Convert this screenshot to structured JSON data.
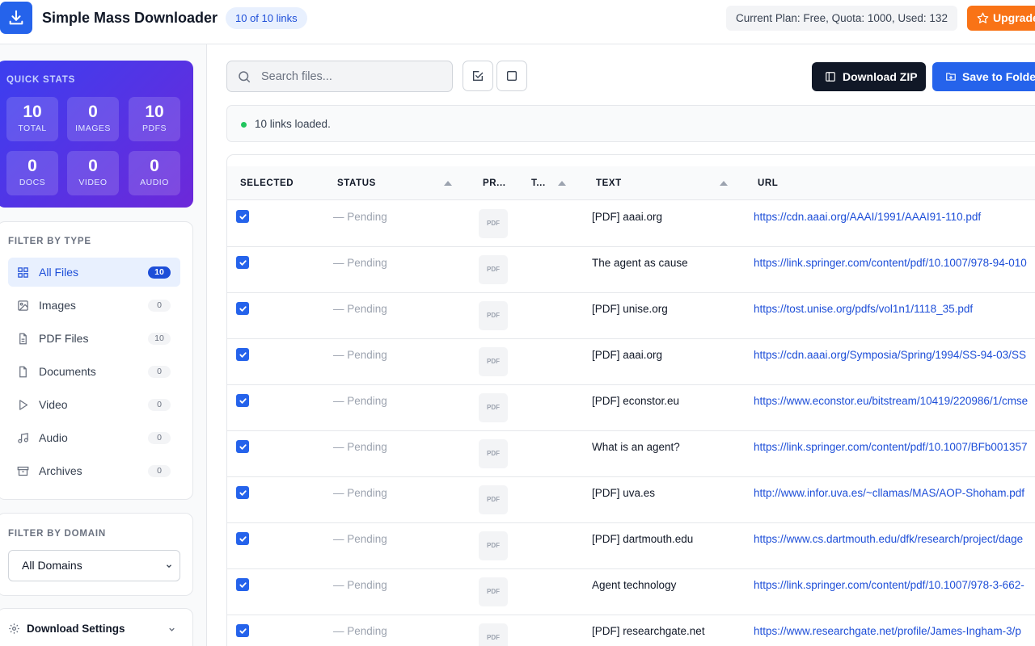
{
  "header": {
    "title": "Simple Mass Downloader",
    "link_count": "10 of 10 links",
    "plan": "Current Plan: Free, Quota: 1000, Used: 132",
    "upgrade_label": "Upgrade"
  },
  "stats": {
    "title": "QUICK STATS",
    "items": [
      {
        "value": "10",
        "label": "TOTAL"
      },
      {
        "value": "0",
        "label": "IMAGES"
      },
      {
        "value": "10",
        "label": "PDFS"
      },
      {
        "value": "0",
        "label": "DOCS"
      },
      {
        "value": "0",
        "label": "VIDEO"
      },
      {
        "value": "0",
        "label": "AUDIO"
      }
    ]
  },
  "filter_type": {
    "title": "FILTER BY TYPE",
    "items": [
      {
        "label": "All Files",
        "count": "10",
        "icon": "grid-icon"
      },
      {
        "label": "Images",
        "count": "0",
        "icon": "image-icon"
      },
      {
        "label": "PDF Files",
        "count": "10",
        "icon": "file-text-icon"
      },
      {
        "label": "Documents",
        "count": "0",
        "icon": "document-icon"
      },
      {
        "label": "Video",
        "count": "0",
        "icon": "play-icon"
      },
      {
        "label": "Audio",
        "count": "0",
        "icon": "music-icon"
      },
      {
        "label": "Archives",
        "count": "0",
        "icon": "archive-icon"
      }
    ]
  },
  "filter_domain": {
    "title": "FILTER BY DOMAIN",
    "selected": "All Domains"
  },
  "settings": {
    "label": "Download Settings"
  },
  "toolbar": {
    "search_placeholder": "Search files...",
    "zip_label": "Download ZIP",
    "folder_label": "Save to Folder"
  },
  "status": {
    "message": "10 links loaded."
  },
  "table": {
    "columns": {
      "selected": "SELECTED",
      "status": "STATUS",
      "preview": "PR...",
      "type": "T...",
      "text": "TEXT",
      "url": "URL"
    },
    "rows": [
      {
        "status": "— Pending",
        "thumb": "PDF",
        "text": "[PDF] aaai.org",
        "url": "https://cdn.aaai.org/AAAI/1991/AAAI91-110.pdf"
      },
      {
        "status": "— Pending",
        "thumb": "PDF",
        "text": "The agent as cause",
        "url": "https://link.springer.com/content/pdf/10.1007/978-94-010"
      },
      {
        "status": "— Pending",
        "thumb": "PDF",
        "text": "[PDF] unise.org",
        "url": "https://tost.unise.org/pdfs/vol1n1/1118_35.pdf"
      },
      {
        "status": "— Pending",
        "thumb": "PDF",
        "text": "[PDF] aaai.org",
        "url": "https://cdn.aaai.org/Symposia/Spring/1994/SS-94-03/SS"
      },
      {
        "status": "— Pending",
        "thumb": "PDF",
        "text": "[PDF] econstor.eu",
        "url": "https://www.econstor.eu/bitstream/10419/220986/1/cmse"
      },
      {
        "status": "— Pending",
        "thumb": "PDF",
        "text": "What is an agent?",
        "url": "https://link.springer.com/content/pdf/10.1007/BFb001357"
      },
      {
        "status": "— Pending",
        "thumb": "PDF",
        "text": "[PDF] uva.es",
        "url": "http://www.infor.uva.es/~cllamas/MAS/AOP-Shoham.pdf"
      },
      {
        "status": "— Pending",
        "thumb": "PDF",
        "text": "[PDF] dartmouth.edu",
        "url": "https://www.cs.dartmouth.edu/dfk/research/project/dage"
      },
      {
        "status": "— Pending",
        "thumb": "PDF",
        "text": "Agent technology",
        "url": "https://link.springer.com/content/pdf/10.1007/978-3-662-"
      },
      {
        "status": "— Pending",
        "thumb": "PDF",
        "text": "[PDF] researchgate.net",
        "url": "https://www.researchgate.net/profile/James-Ingham-3/p"
      }
    ]
  },
  "colors": {
    "accent": "#2563eb",
    "upgrade": "#f97316",
    "success": "#22c55e"
  }
}
